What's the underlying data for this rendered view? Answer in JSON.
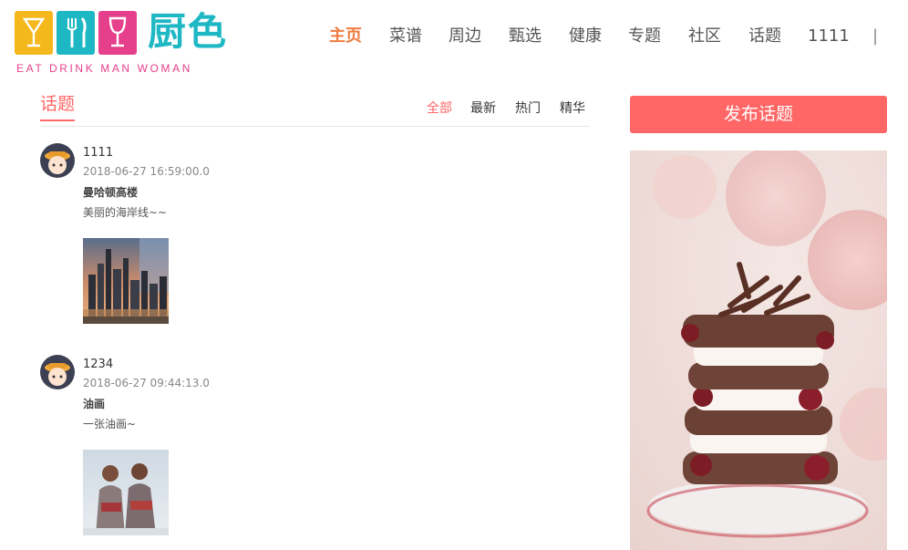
{
  "brand": {
    "name": "厨色",
    "slogan": "EAT DRINK MAN WOMAN"
  },
  "nav": {
    "items": [
      {
        "label": "主页",
        "active": true
      },
      {
        "label": "菜谱",
        "active": false
      },
      {
        "label": "周边",
        "active": false
      },
      {
        "label": "甄选",
        "active": false
      },
      {
        "label": "健康",
        "active": false
      },
      {
        "label": "专题",
        "active": false
      },
      {
        "label": "社区",
        "active": false
      },
      {
        "label": "话题",
        "active": false
      },
      {
        "label": "1111",
        "active": false
      }
    ],
    "separator": "|"
  },
  "topics": {
    "title": "话题",
    "filters": [
      {
        "label": "全部",
        "active": true
      },
      {
        "label": "最新",
        "active": false
      },
      {
        "label": "热门",
        "active": false
      },
      {
        "label": "精华",
        "active": false
      }
    ],
    "posts": [
      {
        "user": "1111",
        "time": "2018-06-27 16:59:00.0",
        "title": "曼哈顿高楼",
        "desc": "美丽的海岸线~~",
        "image_icon": "city-skyline-photo"
      },
      {
        "user": "1234",
        "time": "2018-06-27 09:44:13.0",
        "title": "油画",
        "desc": "一张油画~",
        "image_icon": "oil-painting-photo"
      }
    ]
  },
  "sidebar": {
    "publish_label": "发布话题",
    "ad_icon": "chocolate-cake-photo"
  },
  "colors": {
    "accent": "#ff6666",
    "nav_active": "#f07b3f",
    "brand_teal": "#1eb7c4",
    "brand_pink": "#e63f8b",
    "brand_yellow": "#f5b81c"
  }
}
